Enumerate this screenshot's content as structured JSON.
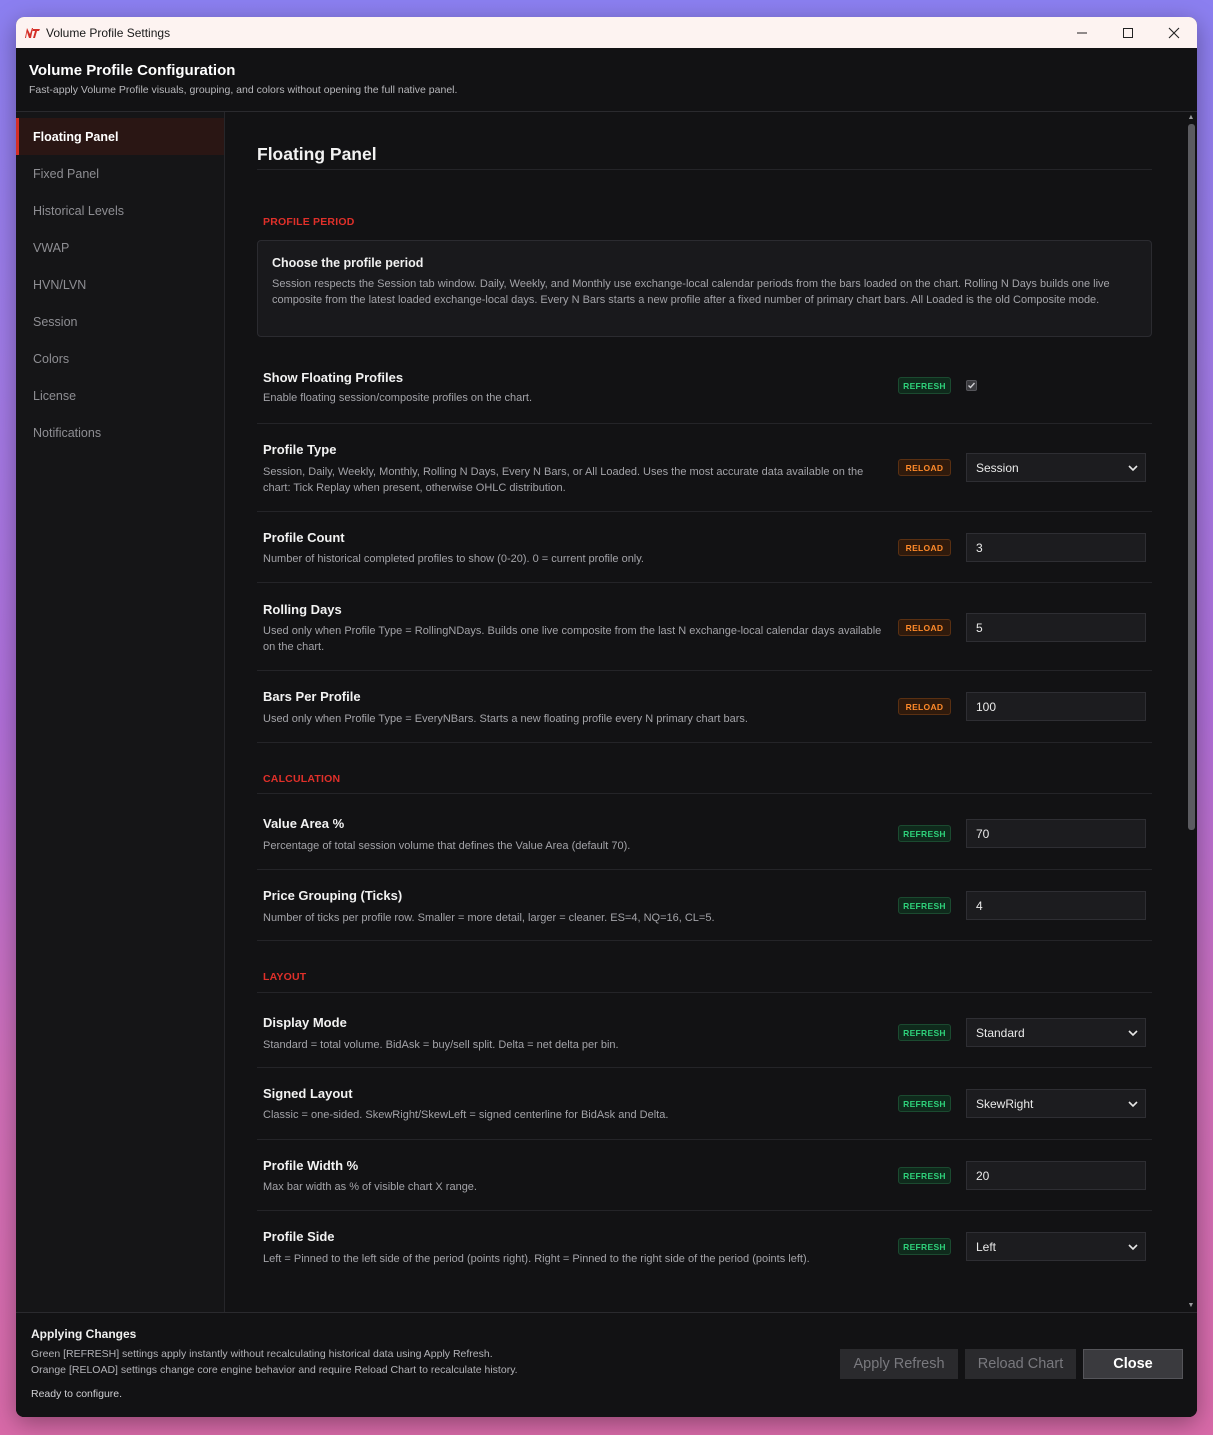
{
  "window": {
    "title": "Volume Profile Settings",
    "controls": {
      "minimize": "─",
      "maximize": "☐",
      "close": "✕"
    }
  },
  "header": {
    "title": "Volume Profile Configuration",
    "subtitle": "Fast-apply Volume Profile visuals, grouping, and colors without opening the full native panel."
  },
  "sidebar": {
    "items": [
      {
        "label": "Floating Panel",
        "active": true
      },
      {
        "label": "Fixed Panel"
      },
      {
        "label": "Historical Levels"
      },
      {
        "label": "VWAP"
      },
      {
        "label": "HVN/LVN"
      },
      {
        "label": "Session"
      },
      {
        "label": "Colors"
      },
      {
        "label": "License"
      },
      {
        "label": "Notifications"
      }
    ]
  },
  "main": {
    "page_title": "Floating Panel",
    "sections": {
      "profile_period": "PROFILE PERIOD",
      "calculation": "CALCULATION",
      "layout": "LAYOUT"
    },
    "info_box": {
      "title": "Choose the profile period",
      "text": "Session respects the Session tab window. Daily, Weekly, and Monthly use exchange-local calendar periods from the bars loaded on the chart. Rolling N Days builds one live composite from the latest loaded exchange-local days. Every N Bars starts a new profile after a fixed number of primary chart bars. All Loaded is the old Composite mode."
    },
    "badges": {
      "refresh": "REFRESH",
      "reload": "RELOAD"
    },
    "settings": [
      {
        "label": "Show Floating Profiles",
        "desc": "Enable floating session/composite profiles on the chart.",
        "badge": "REFRESH",
        "checked": true
      },
      {
        "label": "Profile Type",
        "desc": "Session, Daily, Weekly, Monthly, Rolling N Days, Every N Bars, or All Loaded. Uses the most accurate data available on the chart: Tick Replay when present, otherwise OHLC distribution.",
        "badge": "RELOAD",
        "value": "Session"
      },
      {
        "label": "Profile Count",
        "desc": "Number of historical completed profiles to show (0-20). 0 = current profile only.",
        "badge": "RELOAD",
        "value": "3"
      },
      {
        "label": "Rolling Days",
        "desc": "Used only when Profile Type = RollingNDays. Builds one live composite from the last N exchange-local calendar days available on the chart.",
        "badge": "RELOAD",
        "value": "5"
      },
      {
        "label": "Bars Per Profile",
        "desc": "Used only when Profile Type = EveryNBars. Starts a new floating profile every N primary chart bars.",
        "badge": "RELOAD",
        "value": "100"
      },
      {
        "label": "Value Area %",
        "desc": "Percentage of total session volume that defines the Value Area (default 70).",
        "badge": "REFRESH",
        "value": "70"
      },
      {
        "label": "Price Grouping (Ticks)",
        "desc": "Number of ticks per profile row. Smaller = more detail, larger = cleaner. ES=4, NQ=16, CL=5.",
        "badge": "REFRESH",
        "value": "4"
      },
      {
        "label": "Display Mode",
        "desc": "Standard = total volume. BidAsk = buy/sell split. Delta = net delta per bin.",
        "badge": "REFRESH",
        "value": "Standard"
      },
      {
        "label": "Signed Layout",
        "desc": "Classic = one-sided. SkewRight/SkewLeft = signed centerline for BidAsk and Delta.",
        "badge": "REFRESH",
        "value": "SkewRight"
      },
      {
        "label": "Profile Width %",
        "desc": "Max bar width as % of visible chart X range.",
        "badge": "REFRESH",
        "value": "20"
      },
      {
        "label": "Profile Side",
        "desc": "Left = Pinned to the left side of the period (points right). Right = Pinned to the right side of the period (points left).",
        "badge": "REFRESH",
        "value": "Left"
      }
    ]
  },
  "footer": {
    "title": "Applying Changes",
    "line1": "Green [REFRESH] settings apply instantly without recalculating historical data using Apply Refresh.",
    "line2": "Orange [RELOAD] settings change core engine behavior and require Reload Chart to recalculate history.",
    "status": "Ready to configure.",
    "buttons": {
      "apply_refresh": "Apply Refresh",
      "reload_chart": "Reload Chart",
      "close": "Close"
    }
  },
  "colors": {
    "accent_red": "#d42e26",
    "refresh_green": "#2ed17a",
    "reload_orange": "#ff8a2a"
  }
}
